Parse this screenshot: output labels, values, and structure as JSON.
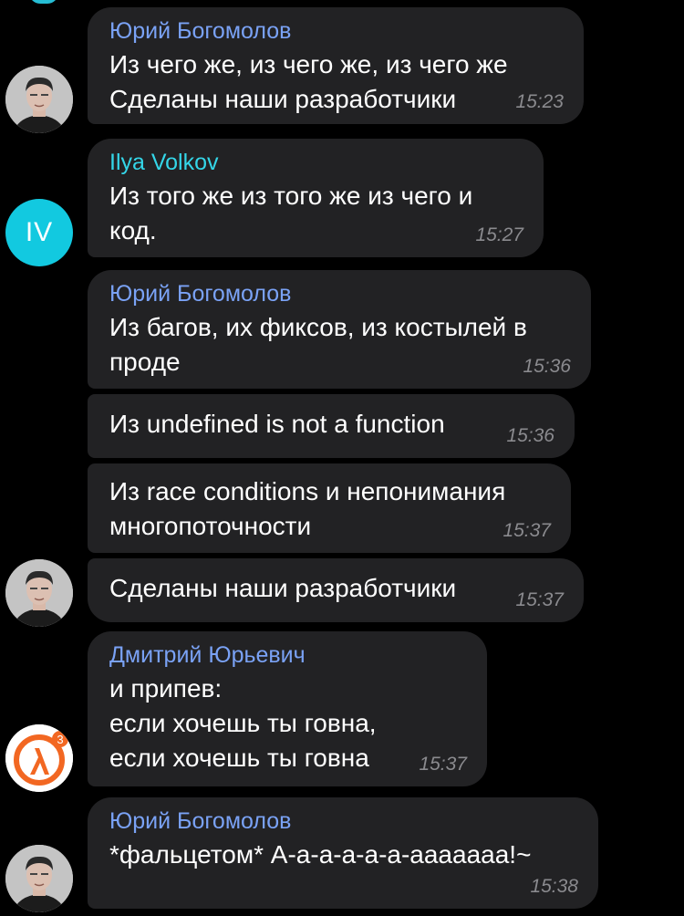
{
  "colors": {
    "background": "#000000",
    "bubble": "#222224",
    "name_yuriy": "#7aa2f5",
    "name_ilya": "#34d6e8",
    "name_dmitriy": "#7aa2f5",
    "time": "#8a8a8e",
    "avatar_iv": "#12c9e0",
    "logo_orange": "#f26722"
  },
  "messages": [
    {
      "sender": "Юрий Богомолов",
      "lines": [
        "Из чего же, из чего же, из чего же",
        "Сделаны наши разработчики"
      ],
      "time": "15:23"
    },
    {
      "sender": "Ilya Volkov",
      "avatar_initials": "IV",
      "lines": [
        "Из того же из того же из чего и",
        "код."
      ],
      "time": "15:27"
    },
    {
      "sender": "Юрий Богомолов",
      "lines": [
        "Из багов, их фиксов, из костылей в",
        "проде"
      ],
      "time": "15:36"
    },
    {
      "lines": [
        "Из undefined is not a function"
      ],
      "time": "15:36"
    },
    {
      "lines": [
        "Из race conditions и непонимания",
        "многопоточности"
      ],
      "time": "15:37"
    },
    {
      "lines": [
        "Сделаны наши разработчики"
      ],
      "time": "15:37"
    },
    {
      "sender": "Дмитрий Юрьевич",
      "lines": [
        "и припев:",
        "если хочешь ты говна,",
        "если хочешь ты говна"
      ],
      "time": "15:37",
      "avatar_badge": "3"
    },
    {
      "sender": "Юрий Богомолов",
      "lines": [
        "*фальцетом* А-а-а-а-а-а-ааааааа!~"
      ],
      "time": "15:38"
    }
  ]
}
